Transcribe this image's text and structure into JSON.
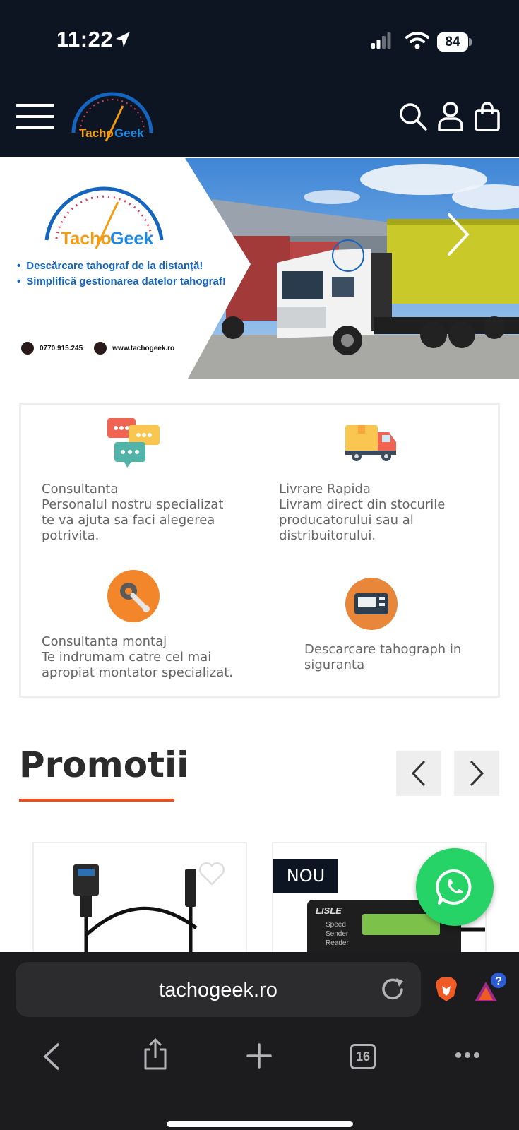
{
  "status": {
    "time": "11:22",
    "battery": "84"
  },
  "header": {
    "logo_alt": "TachoGeek"
  },
  "hero": {
    "logo_text_tacho": "Tacho",
    "logo_text_geek": "Geek",
    "bullets": [
      "Descărcare tahograf de la distanță!",
      "Simplifică gestionarea datelor tahograf!"
    ],
    "phone": "0770.915.245",
    "website": "www.tachogeek.ro"
  },
  "features": [
    {
      "title": "Consultanta",
      "text": "Personalul nostru specializat te va ajuta sa faci alegerea potrivita.",
      "icon": "chat-bubbles-icon"
    },
    {
      "title": "Livrare Rapida",
      "text": "Livram direct din stocurile producatorului sau al distribuitorului.",
      "icon": "delivery-truck-icon"
    },
    {
      "title": "Consultanta montaj",
      "text": "Te indrumam catre cel mai apropiat montator specializat.",
      "icon": "wrench-gear-icon"
    },
    {
      "title": "",
      "text": "Descarcare tahograph in siguranta",
      "icon": "card-reader-icon"
    }
  ],
  "promotii": {
    "title": "Promotii",
    "badge": "NOU",
    "product2_brand": "LISLE",
    "product2_lines": [
      "Speed",
      "Sender",
      "Reader"
    ]
  },
  "browser": {
    "url": "tachogeek.ro",
    "tabs": "16",
    "aurora_badge": "?"
  },
  "colors": {
    "header_bg": "#0c1521",
    "accent": "#ee4f1a",
    "whatsapp": "#25d366",
    "hero_text": "#1565c0"
  }
}
